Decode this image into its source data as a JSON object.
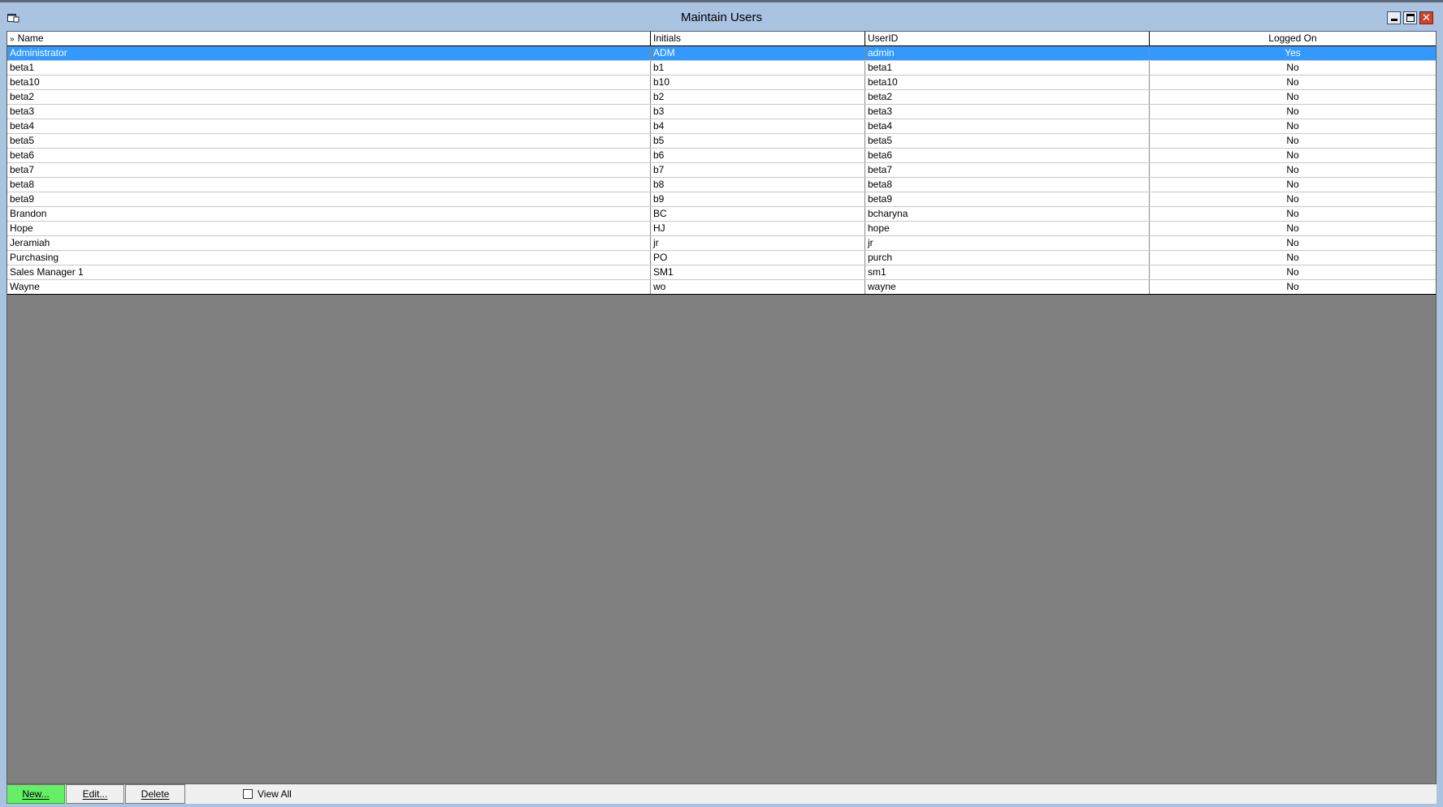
{
  "window": {
    "title": "Maintain Users",
    "icon": "app-window-icon",
    "controls": [
      "minimize-icon",
      "maximize-icon",
      "close-icon"
    ],
    "close_glyph": "✕"
  },
  "grid": {
    "sort_glyph": "»",
    "columns": [
      "Name",
      "Initials",
      "UserID",
      "Logged On"
    ],
    "selected_row": 0,
    "selection_color": "#3399ff",
    "rows": [
      {
        "name": "Administrator",
        "initials": "ADM",
        "userid": "admin",
        "logged_on": "Yes"
      },
      {
        "name": "beta1",
        "initials": "b1",
        "userid": "beta1",
        "logged_on": "No"
      },
      {
        "name": "beta10",
        "initials": "b10",
        "userid": "beta10",
        "logged_on": "No"
      },
      {
        "name": "beta2",
        "initials": "b2",
        "userid": "beta2",
        "logged_on": "No"
      },
      {
        "name": "beta3",
        "initials": "b3",
        "userid": "beta3",
        "logged_on": "No"
      },
      {
        "name": "beta4",
        "initials": "b4",
        "userid": "beta4",
        "logged_on": "No"
      },
      {
        "name": "beta5",
        "initials": "b5",
        "userid": "beta5",
        "logged_on": "No"
      },
      {
        "name": "beta6",
        "initials": "b6",
        "userid": "beta6",
        "logged_on": "No"
      },
      {
        "name": "beta7",
        "initials": "b7",
        "userid": "beta7",
        "logged_on": "No"
      },
      {
        "name": "beta8",
        "initials": "b8",
        "userid": "beta8",
        "logged_on": "No"
      },
      {
        "name": "beta9",
        "initials": "b9",
        "userid": "beta9",
        "logged_on": "No"
      },
      {
        "name": "Brandon",
        "initials": "BC",
        "userid": "bcharyna",
        "logged_on": "No"
      },
      {
        "name": "Hope",
        "initials": "HJ",
        "userid": "hope",
        "logged_on": "No"
      },
      {
        "name": "Jeramiah",
        "initials": "jr",
        "userid": "jr",
        "logged_on": "No"
      },
      {
        "name": "Purchasing",
        "initials": "PO",
        "userid": "purch",
        "logged_on": "No"
      },
      {
        "name": "Sales Manager 1",
        "initials": "SM1",
        "userid": "sm1",
        "logged_on": "No"
      },
      {
        "name": "Wayne",
        "initials": "wo",
        "userid": "wayne",
        "logged_on": "No"
      }
    ]
  },
  "toolbar": {
    "new_label": "New...",
    "edit_label": "Edit...",
    "delete_label": "Delete",
    "view_all_label": "View All",
    "view_all_checked": false,
    "new_button_color": "#66ee66"
  },
  "colors": {
    "title_bar": "#a9c3e0",
    "client_background": "#808080"
  }
}
